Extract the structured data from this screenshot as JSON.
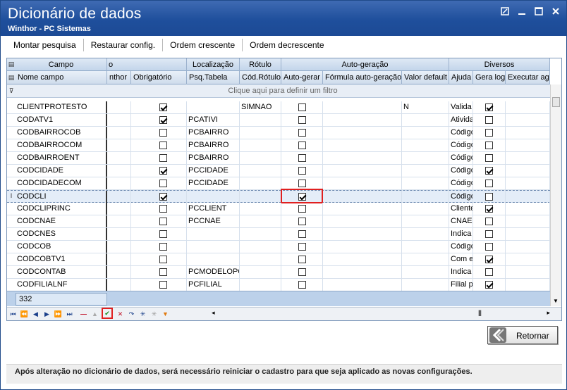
{
  "window": {
    "title": "Dicionário de dados",
    "subtitle": "Winthor - PC Sistemas",
    "buttons": [
      "restore-down-icon",
      "minimize-icon",
      "maximize-icon",
      "close-icon"
    ]
  },
  "toolbar": {
    "items": [
      "Montar pesquisa",
      "Restaurar config.",
      "Ordem crescente",
      "Ordem decrescente"
    ]
  },
  "grid": {
    "bands": [
      "Campo",
      "o",
      "Localização",
      "Rótulo",
      "Auto-geração",
      "Diversos"
    ],
    "columns": [
      "Nome campo",
      "nthor",
      "Obrigatório",
      "Psq.Tabela",
      "Cód.Rótulo",
      "Auto-gerar",
      "Fórmula auto-geração",
      "Valor default",
      "Ajuda",
      "Gera log",
      "Executar ag"
    ],
    "filter_text": "Clique aqui para definir um filtro",
    "selected_row_indicator": "I",
    "rows": [
      {
        "nome": "CLIENTPROTESTO",
        "obrigatorio": true,
        "psq": "",
        "rotulo": "SIMNAO",
        "autogerar": false,
        "valor": "N",
        "ajuda": "Valida",
        "geralog": true
      },
      {
        "nome": "CODATV1",
        "obrigatorio": true,
        "psq": "PCATIVI",
        "rotulo": "",
        "autogerar": false,
        "valor": "",
        "ajuda": "Ativida",
        "geralog": false
      },
      {
        "nome": "CODBAIRROCOB",
        "obrigatorio": false,
        "psq": "PCBAIRRO",
        "rotulo": "",
        "autogerar": false,
        "valor": "",
        "ajuda": "Código",
        "geralog": false
      },
      {
        "nome": "CODBAIRROCOM",
        "obrigatorio": false,
        "psq": "PCBAIRRO",
        "rotulo": "",
        "autogerar": false,
        "valor": "",
        "ajuda": "Código",
        "geralog": false
      },
      {
        "nome": "CODBAIRROENT",
        "obrigatorio": false,
        "psq": "PCBAIRRO",
        "rotulo": "",
        "autogerar": false,
        "valor": "",
        "ajuda": "Código",
        "geralog": false
      },
      {
        "nome": "CODCIDADE",
        "obrigatorio": true,
        "psq": "PCCIDADE",
        "rotulo": "",
        "autogerar": false,
        "valor": "",
        "ajuda": "Código",
        "geralog": true
      },
      {
        "nome": "CODCIDADECOM",
        "obrigatorio": false,
        "psq": "PCCIDADE",
        "rotulo": "",
        "autogerar": false,
        "valor": "",
        "ajuda": "Código",
        "geralog": false
      },
      {
        "nome": "CODCLI",
        "obrigatorio": true,
        "psq": "",
        "rotulo": "",
        "autogerar": true,
        "valor": "",
        "ajuda": "Código",
        "geralog": false,
        "selected": true
      },
      {
        "nome": "CODCLIPRINC",
        "obrigatorio": false,
        "psq": "PCCLIENT",
        "rotulo": "",
        "autogerar": false,
        "valor": "",
        "ajuda": "Cliente",
        "geralog": true
      },
      {
        "nome": "CODCNAE",
        "obrigatorio": false,
        "psq": "PCCNAE",
        "rotulo": "",
        "autogerar": false,
        "valor": "",
        "ajuda": "CNAE",
        "geralog": false
      },
      {
        "nome": "CODCNES",
        "obrigatorio": false,
        "psq": "",
        "rotulo": "",
        "autogerar": false,
        "valor": "",
        "ajuda": "Indica",
        "geralog": false
      },
      {
        "nome": "CODCOB",
        "obrigatorio": false,
        "psq": "",
        "rotulo": "",
        "autogerar": false,
        "valor": "",
        "ajuda": "Código",
        "geralog": false
      },
      {
        "nome": "CODCOBTV1",
        "obrigatorio": false,
        "psq": "",
        "rotulo": "",
        "autogerar": false,
        "valor": "",
        "ajuda": "Com e",
        "geralog": true
      },
      {
        "nome": "CODCONTAB",
        "obrigatorio": false,
        "psq": "PCMODELOPC",
        "rotulo": "",
        "autogerar": false,
        "valor": "",
        "ajuda": "Indica",
        "geralog": false
      },
      {
        "nome": "CODFILIALNF",
        "obrigatorio": false,
        "psq": "PCFILIAL",
        "rotulo": "",
        "autogerar": false,
        "valor": "",
        "ajuda": "Filial p",
        "geralog": true
      }
    ],
    "record_count": "332"
  },
  "return_button": {
    "label": "Retornar",
    "icon": "back-arrow-icon"
  },
  "status_message": "Após alteração no dicionário de dados, será necessário reiniciar o cadastro para que seja aplicado as novas configurações."
}
